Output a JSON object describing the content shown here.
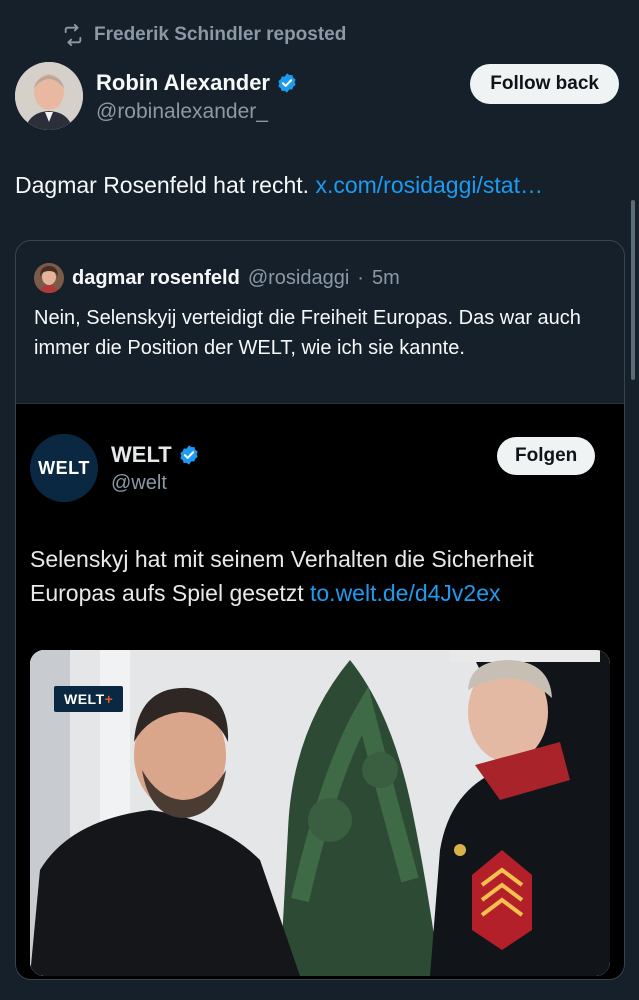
{
  "repost": {
    "text": "Frederik Schindler reposted",
    "icon": "repost-icon"
  },
  "author": {
    "name": "Robin Alexander",
    "handle": "@robinalexander_",
    "verified": true,
    "follow_label": "Follow back"
  },
  "tweet": {
    "text": "Dagmar Rosenfeld hat recht. ",
    "link": "x.com/rosidaggi/stat…"
  },
  "quote": {
    "name": "dagmar rosenfeld",
    "handle": "@rosidaggi",
    "separator": " · ",
    "time": "5m",
    "text": "Nein, Selenskyij verteidigt die Freiheit Europas. Das war auch immer die Position der WELT, wie ich sie kannte."
  },
  "embedded": {
    "logo_text": "WELT",
    "name": "WELT",
    "handle": "@welt",
    "verified": true,
    "follow_label": "Folgen",
    "text": "Selenskyj hat mit seinem Verhalten die Sicherheit Europas aufs Spiel gesetzt ",
    "link": "to.welt.de/d4Jv2ex",
    "photo_badge": "WELT",
    "photo_badge_plus": "+"
  },
  "colors": {
    "background": "#15202b",
    "accent": "#1d9bf0",
    "muted": "#8b98a5",
    "welt_navy": "#0b2842"
  }
}
